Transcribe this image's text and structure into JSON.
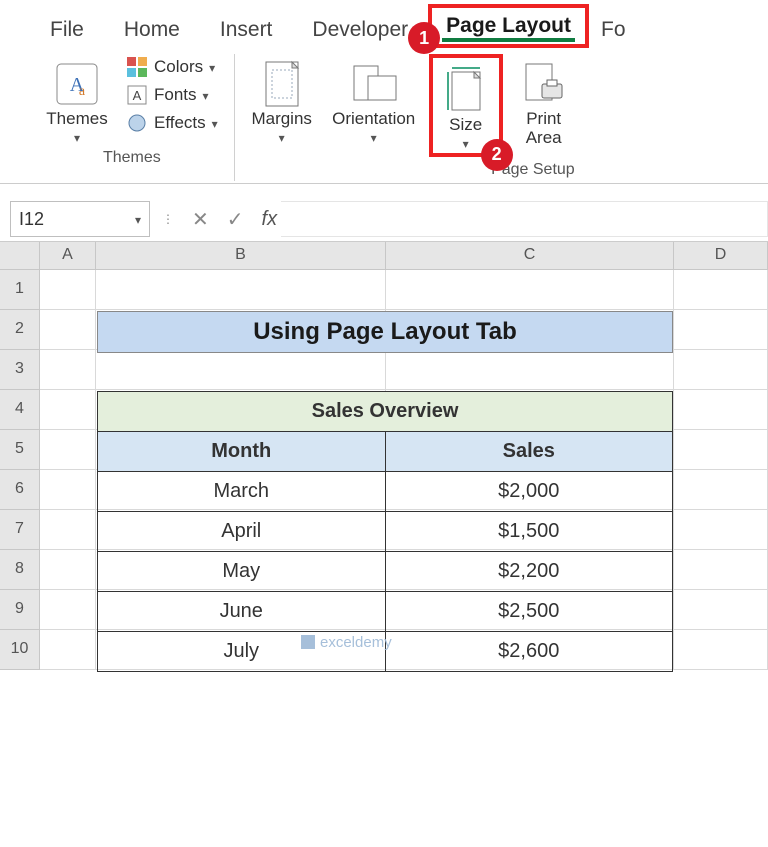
{
  "tabs": {
    "file": "File",
    "home": "Home",
    "insert": "Insert",
    "developer": "Developer",
    "pagelayout": "Page Layout",
    "formulas_partial": "Fo"
  },
  "ribbon": {
    "themes_group_label": "Themes",
    "themes_btn": "Themes",
    "colors_btn": "Colors",
    "fonts_btn": "Fonts",
    "effects_btn": "Effects",
    "margins_btn": "Margins",
    "orientation_btn": "Orientation",
    "size_btn": "Size",
    "printarea_btn": "Print\nArea",
    "pagesetup_group_label": "Page Setup"
  },
  "callouts": {
    "one": "1",
    "two": "2"
  },
  "name_box": "I12",
  "fx_label": "fx",
  "columns": [
    "A",
    "B",
    "C",
    "D"
  ],
  "rows": [
    "1",
    "2",
    "3",
    "4",
    "5",
    "6",
    "7",
    "8",
    "9",
    "10"
  ],
  "banner": "Using Page Layout Tab",
  "table": {
    "title": "Sales Overview",
    "col1": "Month",
    "col2": "Sales",
    "data": [
      {
        "m": "March",
        "s": "$2,000"
      },
      {
        "m": "April",
        "s": "$1,500"
      },
      {
        "m": "May",
        "s": "$2,200"
      },
      {
        "m": "June",
        "s": "$2,500"
      },
      {
        "m": "July",
        "s": "$2,600"
      }
    ]
  },
  "watermark": "exceldemy"
}
